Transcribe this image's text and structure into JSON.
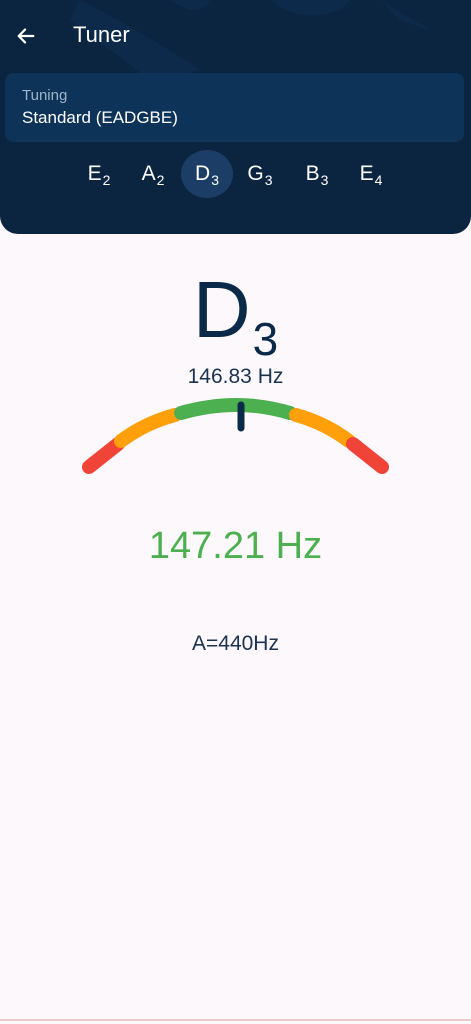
{
  "header": {
    "title": "Tuner",
    "back_icon": "arrow-left-icon"
  },
  "tuning": {
    "label": "Tuning",
    "value": "Standard (EADGBE)"
  },
  "strings": [
    {
      "note": "E",
      "octave": "2",
      "active": false
    },
    {
      "note": "A",
      "octave": "2",
      "active": false
    },
    {
      "note": "D",
      "octave": "3",
      "active": true
    },
    {
      "note": "G",
      "octave": "3",
      "active": false
    },
    {
      "note": "B",
      "octave": "3",
      "active": false
    },
    {
      "note": "E",
      "octave": "4",
      "active": false
    }
  ],
  "current": {
    "note": "D",
    "octave": "3",
    "target_frequency": "146.83 Hz",
    "detected_frequency": "147.21 Hz"
  },
  "gauge": {
    "needle_level": 0.5
  },
  "reference": "A=440Hz",
  "colors": {
    "header_bg": "#0b2440",
    "card_bg": "#0d3358",
    "in_tune": "#4caf50",
    "warning": "#ff9f0a",
    "error": "#f04438",
    "needle": "#0b2a4a"
  }
}
